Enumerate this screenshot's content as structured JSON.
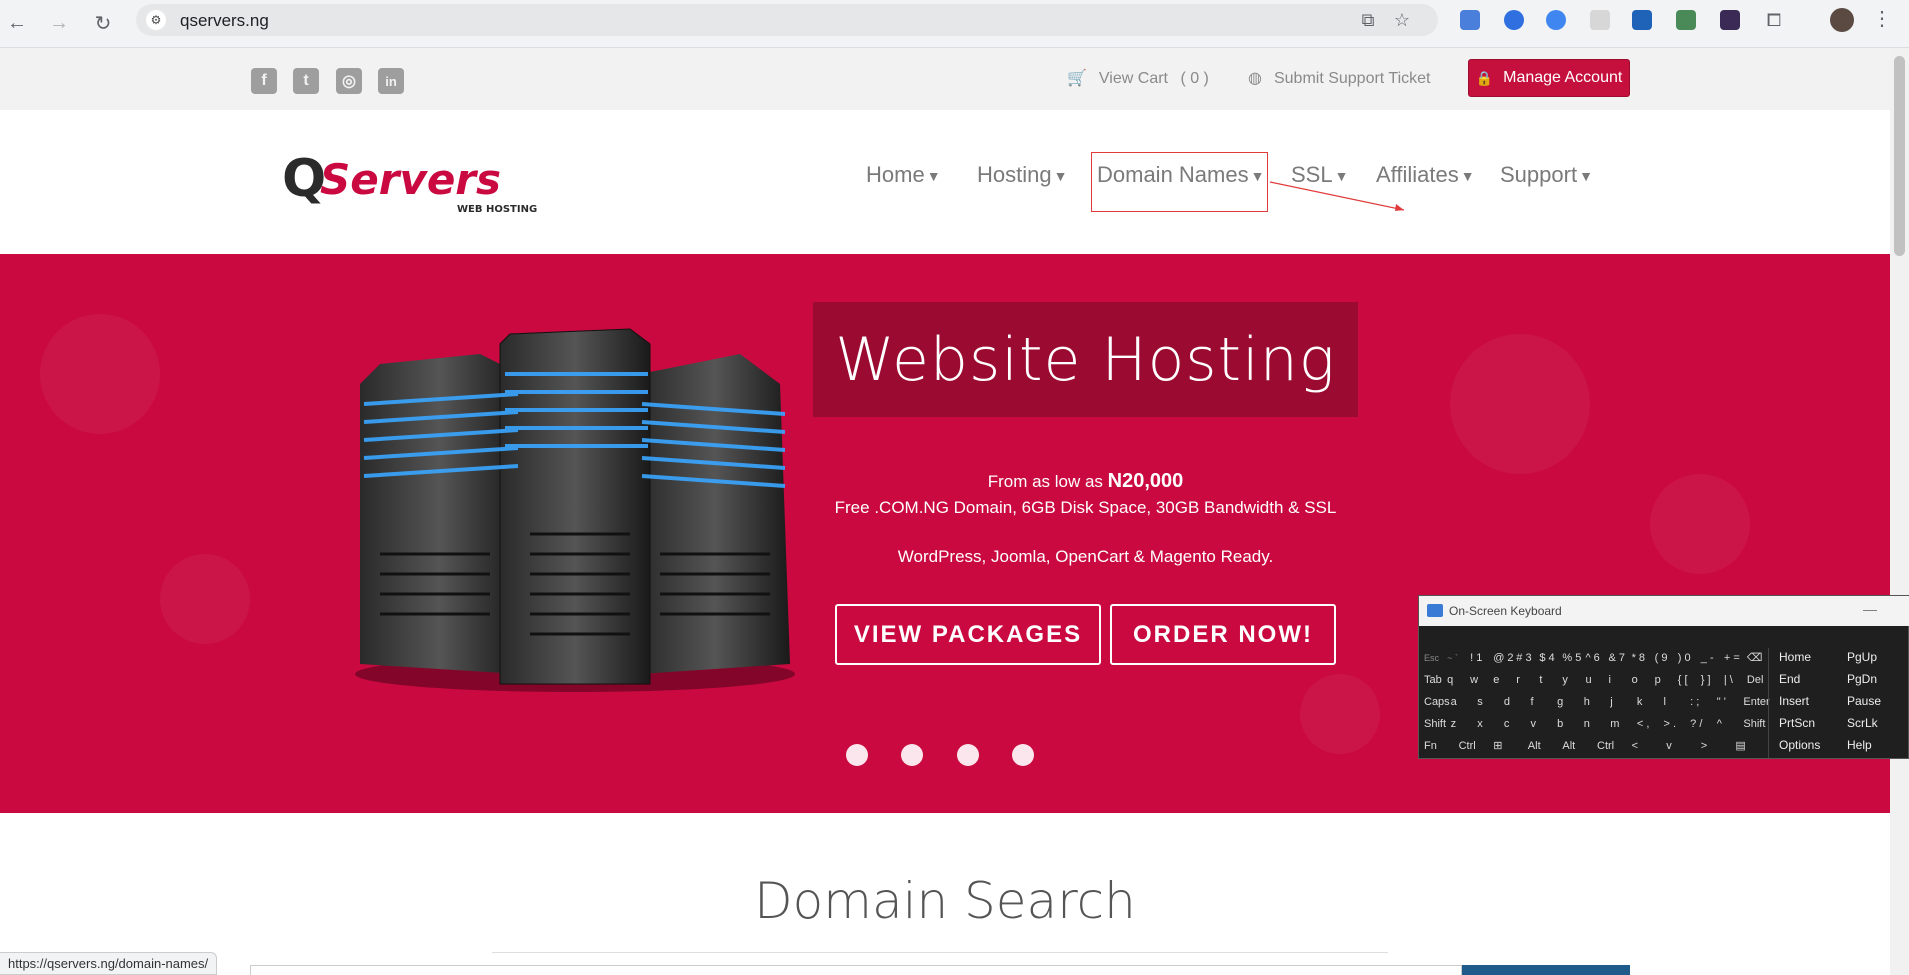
{
  "browser": {
    "url": "qservers.ng",
    "status_url": "https://qservers.ng/domain-names/"
  },
  "topbar": {
    "view_cart": "View Cart",
    "cart_count": "( 0 )",
    "support_ticket": "Submit Support Ticket",
    "manage_account": "Manage Account"
  },
  "nav": {
    "items": [
      {
        "label": "Home"
      },
      {
        "label": "Hosting"
      },
      {
        "label": "Domain Names"
      },
      {
        "label": "SSL"
      },
      {
        "label": "Affiliates"
      },
      {
        "label": "Support"
      }
    ]
  },
  "logo": {
    "brand": "QServers",
    "tagline": "WEB HOSTING"
  },
  "hero": {
    "title": "Website Hosting",
    "price_prefix": "From as low as ",
    "price": "N20,000",
    "features": "Free .COM.NG Domain, 6GB Disk Space, 30GB Bandwidth & SSL",
    "ready": "WordPress, Joomla, OpenCart & Magento Ready.",
    "btn_packages": "VIEW PACKAGES",
    "btn_order": "ORDER NOW!"
  },
  "domain_search": {
    "title": "Domain Search"
  },
  "osk": {
    "title": "On-Screen Keyboard",
    "rows": [
      [
        {
          "label": "Esc",
          "dim": true
        },
        {
          "label": "~ `",
          "dim": true
        },
        {
          "label": "! 1"
        },
        {
          "label": "@ 2"
        },
        {
          "label": "# 3"
        },
        {
          "label": "$ 4"
        },
        {
          "label": "% 5"
        },
        {
          "label": "^ 6"
        },
        {
          "label": "& 7"
        },
        {
          "label": "* 8"
        },
        {
          "label": "( 9"
        },
        {
          "label": ") 0"
        },
        {
          "label": "_ -"
        },
        {
          "label": "+ ="
        },
        {
          "label": "⌫"
        }
      ],
      [
        {
          "label": "Tab"
        },
        {
          "label": "q"
        },
        {
          "label": "w"
        },
        {
          "label": "e"
        },
        {
          "label": "r"
        },
        {
          "label": "t"
        },
        {
          "label": "y"
        },
        {
          "label": "u"
        },
        {
          "label": "i"
        },
        {
          "label": "o"
        },
        {
          "label": "p"
        },
        {
          "label": "{ ["
        },
        {
          "label": "} ]"
        },
        {
          "label": "| \\"
        },
        {
          "label": "Del"
        }
      ],
      [
        {
          "label": "Caps"
        },
        {
          "label": "a"
        },
        {
          "label": "s"
        },
        {
          "label": "d"
        },
        {
          "label": "f"
        },
        {
          "label": "g"
        },
        {
          "label": "h"
        },
        {
          "label": "j"
        },
        {
          "label": "k"
        },
        {
          "label": "l"
        },
        {
          "label": ": ;"
        },
        {
          "label": "\" '"
        },
        {
          "label": "Enter"
        }
      ],
      [
        {
          "label": "Shift"
        },
        {
          "label": "z"
        },
        {
          "label": "x"
        },
        {
          "label": "c"
        },
        {
          "label": "v"
        },
        {
          "label": "b"
        },
        {
          "label": "n"
        },
        {
          "label": "m"
        },
        {
          "label": "< ,"
        },
        {
          "label": "> ."
        },
        {
          "label": "? /"
        },
        {
          "label": "^"
        },
        {
          "label": "Shift"
        }
      ],
      [
        {
          "label": "Fn"
        },
        {
          "label": "Ctrl"
        },
        {
          "label": "⊞"
        },
        {
          "label": "Alt"
        },
        {
          "label": "Alt"
        },
        {
          "label": "Ctrl"
        },
        {
          "label": "<"
        },
        {
          "label": "v"
        },
        {
          "label": ">"
        },
        {
          "label": "▤"
        }
      ]
    ],
    "nav_keys": [
      [
        "Home",
        "PgUp"
      ],
      [
        "End",
        "PgDn"
      ],
      [
        "Insert",
        "Pause"
      ],
      [
        "PrtScn",
        "ScrLk"
      ],
      [
        "Options",
        "Help"
      ]
    ]
  },
  "colors": {
    "brand_red": "#c9093f",
    "title_box": "#9b0a30",
    "manage_btn": "#c5103d",
    "highlight_box": "#e03a3a"
  }
}
